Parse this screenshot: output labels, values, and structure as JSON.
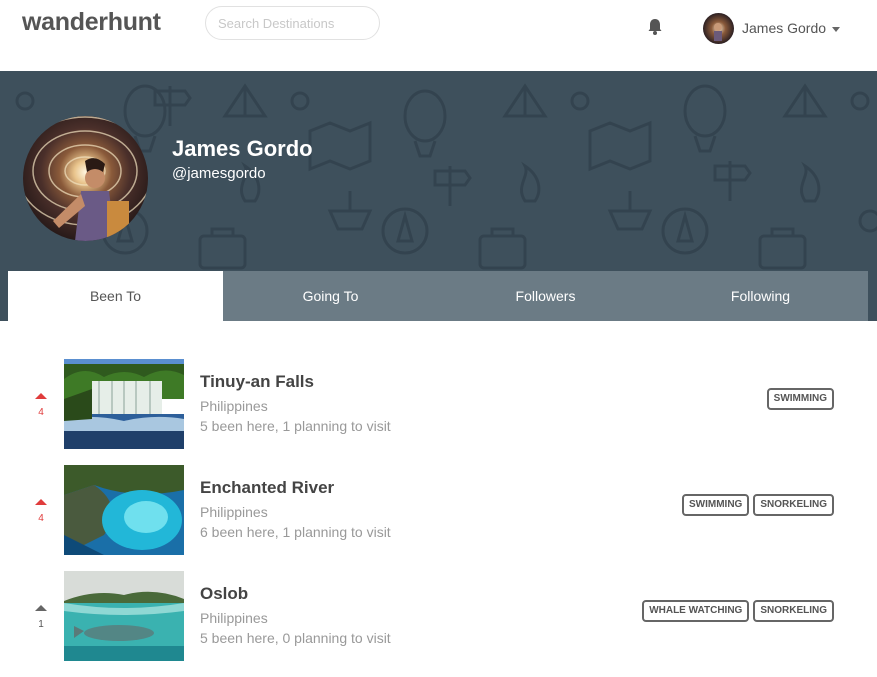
{
  "header": {
    "logo": "wanderhunt",
    "search_placeholder": "Search Destinations",
    "bell_icon": "bell-icon",
    "user_name": "James Gordo"
  },
  "profile": {
    "name": "James Gordo",
    "handle": "@jamesgordo"
  },
  "tabs": [
    {
      "label": "Been To",
      "active": true
    },
    {
      "label": "Going To",
      "active": false
    },
    {
      "label": "Followers",
      "active": false
    },
    {
      "label": "Following",
      "active": false
    }
  ],
  "destinations": [
    {
      "votes": "4",
      "voted": true,
      "title": "Tinuy-an Falls",
      "country": "Philippines",
      "stats": "5 been here, 1 planning to visit",
      "tags": [
        "SWIMMING"
      ]
    },
    {
      "votes": "4",
      "voted": true,
      "title": "Enchanted River",
      "country": "Philippines",
      "stats": "6 been here, 1 planning to visit",
      "tags": [
        "SWIMMING",
        "SNORKELING"
      ]
    },
    {
      "votes": "1",
      "voted": false,
      "title": "Oslob",
      "country": "Philippines",
      "stats": "5 been here, 0 planning to visit",
      "tags": [
        "WHALE WATCHING",
        "SNORKELING"
      ]
    }
  ],
  "colors": {
    "banner": "#3e505c",
    "upvote_active": "#e03c3c",
    "upvote_inactive": "#666666"
  }
}
